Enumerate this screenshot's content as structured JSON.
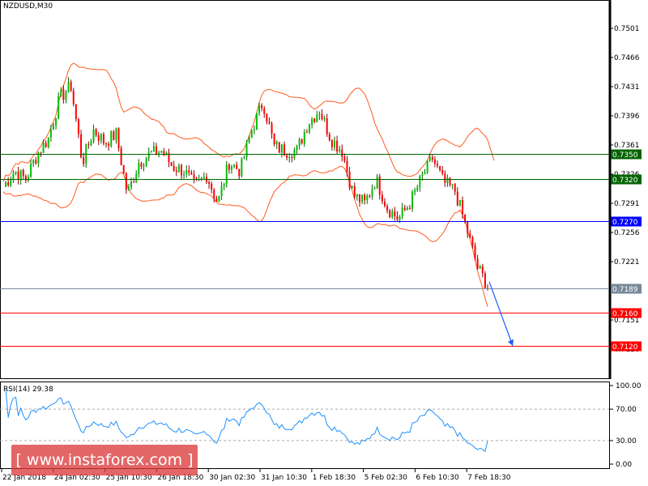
{
  "chart_data": {
    "type": "candlestick",
    "title": "NZDUSD,M30",
    "symbol": "NZDUSD",
    "timeframe": "M30",
    "price_ticks": [
      "0.7501",
      "0.7466",
      "0.7431",
      "0.7396",
      "0.7361",
      "0.7326",
      "0.7291",
      "0.7256",
      "0.7221",
      "0.7186",
      "0.7151",
      "0.7116"
    ],
    "ylim": [
      0.7081,
      0.7535
    ],
    "x_ticks": [
      "22 Jan 2018",
      "24 Jan 02:30",
      "25 Jan 10:30",
      "26 Jan 18:30",
      "30 Jan 02:30",
      "31 Jan 10:30",
      "1 Feb 18:30",
      "5 Feb 02:30",
      "6 Feb 10:30",
      "7 Feb 18:30"
    ],
    "approx_closes": [
      0.7311,
      0.733,
      0.732,
      0.735,
      0.7369,
      0.7417,
      0.7432,
      0.734,
      0.7379,
      0.7364,
      0.7374,
      0.7301,
      0.734,
      0.735,
      0.7354,
      0.7335,
      0.733,
      0.7311,
      0.7325,
      0.7291,
      0.734,
      0.733,
      0.7379,
      0.7413,
      0.7359,
      0.7354,
      0.7354,
      0.7388,
      0.7403,
      0.7369,
      0.7354,
      0.7301,
      0.7291,
      0.732,
      0.7286,
      0.7272,
      0.7291,
      0.732,
      0.7345,
      0.7316,
      0.7306,
      0.7262,
      0.7214,
      0.7189
    ],
    "indicators": [
      "Bollinger Bands",
      "RSI(14)"
    ],
    "levels": [
      {
        "value": "0.7350",
        "color": "#006400"
      },
      {
        "value": "0.7320",
        "color": "#006400"
      },
      {
        "value": "0.7270",
        "color": "#0000ff"
      },
      {
        "value": "0.7189",
        "color": "#778899",
        "current_price": true
      },
      {
        "value": "0.7160",
        "color": "#ff0000"
      },
      {
        "value": "0.7120",
        "color": "#ff0000"
      }
    ],
    "forecast_arrow": {
      "from": 0.7189,
      "to": 0.712,
      "color": "#1e5aff"
    },
    "rsi": {
      "label": "RSI(14) 29.38",
      "ticks": [
        "100.00",
        "70.00",
        "30.00",
        "0.00"
      ],
      "levels": [
        70,
        30
      ],
      "ylim": [
        0,
        100
      ],
      "color": "#1e90ff"
    },
    "colors": {
      "bull": "#00c000",
      "bear": "#ff0000",
      "bands": "#ff5a1e"
    }
  },
  "watermark": "[ www.instaforex.com ]"
}
